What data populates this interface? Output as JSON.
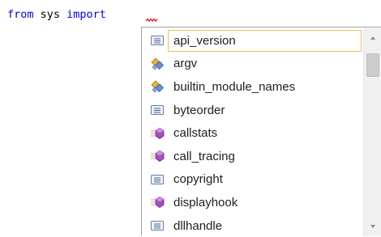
{
  "editor": {
    "kw_from": "from",
    "module": " sys ",
    "kw_import": "import"
  },
  "completion": {
    "items": [
      {
        "label": "api_version",
        "icon": "field-icon"
      },
      {
        "label": "argv",
        "icon": "property-icon"
      },
      {
        "label": "builtin_module_names",
        "icon": "property-icon"
      },
      {
        "label": "byteorder",
        "icon": "field-icon"
      },
      {
        "label": "callstats",
        "icon": "method-icon"
      },
      {
        "label": "call_tracing",
        "icon": "method-icon"
      },
      {
        "label": "copyright",
        "icon": "field-icon"
      },
      {
        "label": "displayhook",
        "icon": "method-icon"
      },
      {
        "label": "dllhandle",
        "icon": "field-icon"
      }
    ],
    "selected_index": 0,
    "scroll_fraction": 0.05
  },
  "colors": {
    "keyword": "#0000ff",
    "error_squiggle": "#ff0000",
    "selection_border": "#e5c365"
  }
}
